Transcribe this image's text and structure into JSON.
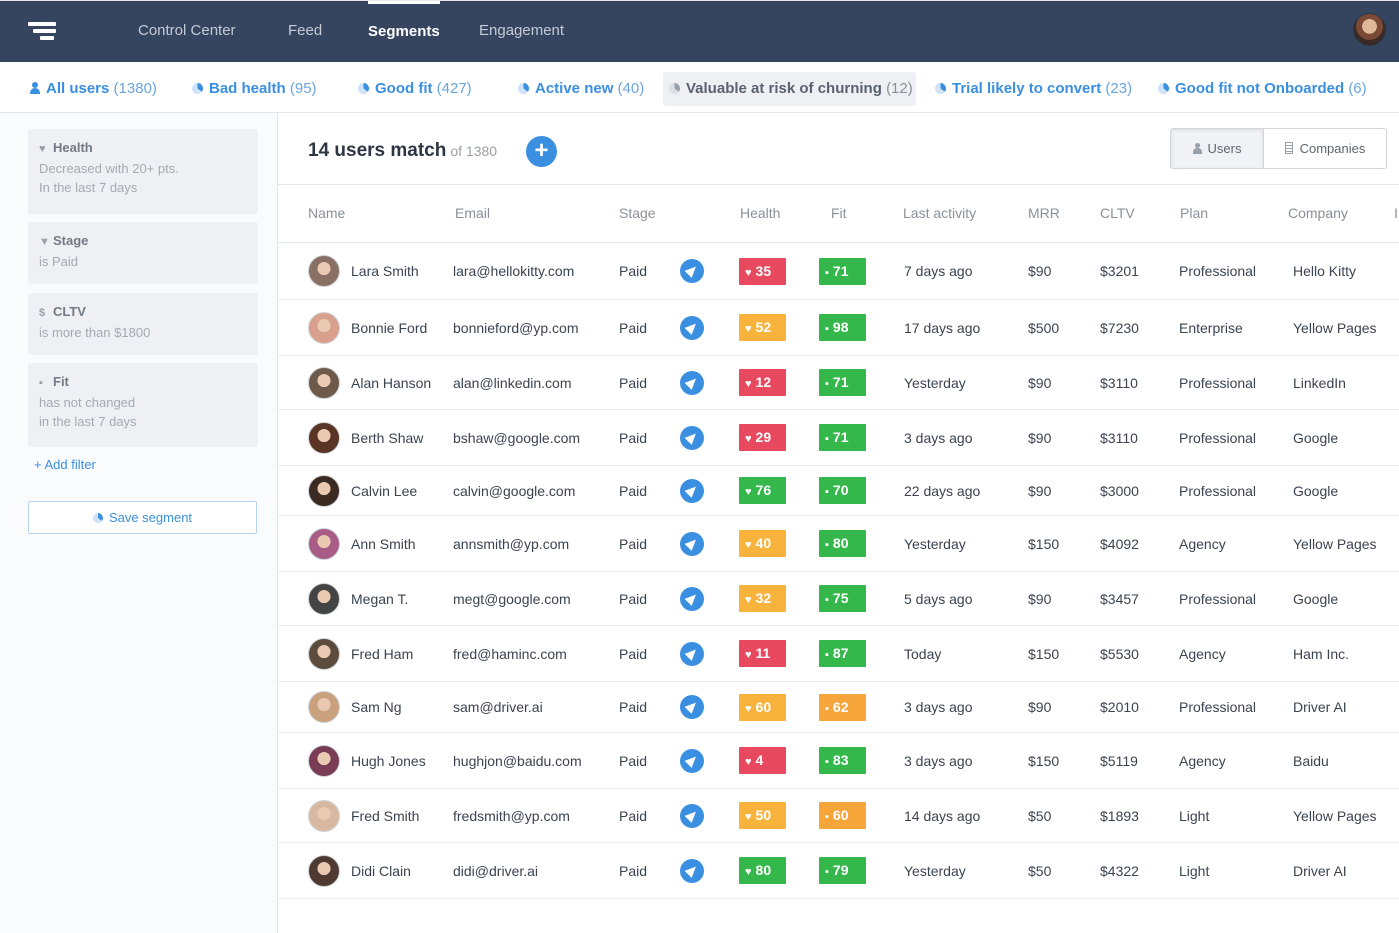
{
  "nav": {
    "items": [
      {
        "label": "Control Center",
        "active": false
      },
      {
        "label": "Feed",
        "active": false
      },
      {
        "label": "Segments",
        "active": true
      },
      {
        "label": "Engagement",
        "active": false
      }
    ]
  },
  "segments": [
    {
      "label": "All users",
      "count": "(1380)",
      "icon": "user-icon"
    },
    {
      "label": "Bad health",
      "count": "(95)",
      "icon": "segment-icon"
    },
    {
      "label": "Good fit",
      "count": "(427)",
      "icon": "segment-icon"
    },
    {
      "label": "Active new",
      "count": "(40)",
      "icon": "segment-icon"
    },
    {
      "label": "Valuable at risk of churning",
      "count": "(12)",
      "icon": "segment-icon",
      "active": true
    },
    {
      "label": "Trial likely to convert",
      "count": "(23)",
      "icon": "segment-icon"
    },
    {
      "label": "Good fit not Onboarded",
      "count": "(6)",
      "icon": "segment-icon"
    }
  ],
  "filters": [
    {
      "title": "Health",
      "icon": "heart-icon",
      "glyph": "♥",
      "desc": [
        "Decreased with 20+ pts.",
        "In the last 7 days"
      ]
    },
    {
      "title": "Stage",
      "icon": "funnel-icon",
      "glyph": "▼",
      "desc": [
        "is Paid"
      ]
    },
    {
      "title": "CLTV",
      "icon": "dollar-icon",
      "glyph": "$",
      "desc": [
        "is more than $1800"
      ]
    },
    {
      "title": "Fit",
      "icon": "fit-icon",
      "glyph": "▪",
      "desc": [
        "has not changed",
        "in the last 7 days"
      ]
    }
  ],
  "sidebar": {
    "add_filter": "+ Add filter",
    "save_segment": "Save segment"
  },
  "main": {
    "match_text": "14 users match",
    "of_text": "of 1380",
    "add_label": "+",
    "toggle": {
      "users": "Users",
      "companies": "Companies"
    }
  },
  "columns": [
    "Name",
    "Email",
    "Stage",
    "Health",
    "Fit",
    "Last activity",
    "MRR",
    "CLTV",
    "Plan",
    "Company",
    "I"
  ],
  "rows": [
    {
      "name": "Lara Smith",
      "email": "lara@hellokitty.com",
      "stage": "Paid",
      "health": "35",
      "health_color": "#e8495f",
      "fit": "71",
      "fit_color": "#35b84b",
      "last": "7 days ago",
      "mrr": "$90",
      "cltv": "$3201",
      "plan": "Professional",
      "company": "Hello Kitty",
      "avatar_color": "#8a7064"
    },
    {
      "name": "Bonnie Ford",
      "email": "bonnieford@yp.com",
      "stage": "Paid",
      "health": "52",
      "health_color": "#f8b33d",
      "fit": "98",
      "fit_color": "#35b84b",
      "last": "17 days ago",
      "mrr": "$500",
      "cltv": "$7230",
      "plan": "Enterprise",
      "company": "Yellow Pages",
      "avatar_color": "#d9a08e"
    },
    {
      "name": "Alan Hanson",
      "email": "alan@linkedin.com",
      "stage": "Paid",
      "health": "12",
      "health_color": "#e8495f",
      "fit": "71",
      "fit_color": "#35b84b",
      "last": "Yesterday",
      "mrr": "$90",
      "cltv": "$3110",
      "plan": "Professional",
      "company": "LinkedIn",
      "avatar_color": "#6d5a4a"
    },
    {
      "name": "Berth Shaw",
      "email": "bshaw@google.com",
      "stage": "Paid",
      "health": "29",
      "health_color": "#e8495f",
      "fit": "71",
      "fit_color": "#35b84b",
      "last": "3 days ago",
      "mrr": "$90",
      "cltv": "$3110",
      "plan": "Professional",
      "company": "Google",
      "avatar_color": "#5a3526"
    },
    {
      "name": "Calvin Lee",
      "email": "calvin@google.com",
      "stage": "Paid",
      "health": "76",
      "health_color": "#35b84b",
      "fit": "70",
      "fit_color": "#35b84b",
      "last": "22 days ago",
      "mrr": "$90",
      "cltv": "$3000",
      "plan": "Professional",
      "company": "Google",
      "avatar_color": "#3a2a22"
    },
    {
      "name": "Ann Smith",
      "email": "annsmith@yp.com",
      "stage": "Paid",
      "health": "40",
      "health_color": "#f8b33d",
      "fit": "80",
      "fit_color": "#35b84b",
      "last": "Yesterday",
      "mrr": "$150",
      "cltv": "$4092",
      "plan": "Agency",
      "company": "Yellow Pages",
      "avatar_color": "#a85d86"
    },
    {
      "name": "Megan T.",
      "email": "megt@google.com",
      "stage": "Paid",
      "health": "32",
      "health_color": "#f8b33d",
      "fit": "75",
      "fit_color": "#35b84b",
      "last": "5 days ago",
      "mrr": "$90",
      "cltv": "$3457",
      "plan": "Professional",
      "company": "Google",
      "avatar_color": "#444444"
    },
    {
      "name": "Fred Ham",
      "email": "fred@haminc.com",
      "stage": "Paid",
      "health": "11",
      "health_color": "#e8495f",
      "fit": "87",
      "fit_color": "#35b84b",
      "last": "Today",
      "mrr": "$150",
      "cltv": "$5530",
      "plan": "Agency",
      "company": "Ham Inc.",
      "avatar_color": "#5b4c3e"
    },
    {
      "name": "Sam Ng",
      "email": "sam@driver.ai",
      "stage": "Paid",
      "health": "60",
      "health_color": "#f8b33d",
      "fit": "62",
      "fit_color": "#f5a53a",
      "last": "3 days ago",
      "mrr": "$90",
      "cltv": "$2010",
      "plan": "Professional",
      "company": "Driver AI",
      "avatar_color": "#c9a27d"
    },
    {
      "name": "Hugh Jones",
      "email": "hughjon@baidu.com",
      "stage": "Paid",
      "health": "4",
      "health_color": "#e8495f",
      "fit": "83",
      "fit_color": "#35b84b",
      "last": "3 days ago",
      "mrr": "$150",
      "cltv": "$5119",
      "plan": "Agency",
      "company": "Baidu",
      "avatar_color": "#7a3c55"
    },
    {
      "name": "Fred Smith",
      "email": "fredsmith@yp.com",
      "stage": "Paid",
      "health": "50",
      "health_color": "#f8b33d",
      "fit": "60",
      "fit_color": "#f5a53a",
      "last": "14 days ago",
      "mrr": "$50",
      "cltv": "$1893",
      "plan": "Light",
      "company": "Yellow Pages",
      "avatar_color": "#d8b8a0"
    },
    {
      "name": "Didi Clain",
      "email": "didi@driver.ai",
      "stage": "Paid",
      "health": "80",
      "health_color": "#35b84b",
      "fit": "79",
      "fit_color": "#35b84b",
      "last": "Yesterday",
      "mrr": "$50",
      "cltv": "$4322",
      "plan": "Light",
      "company": "Driver AI",
      "avatar_color": "#4e3a30"
    }
  ]
}
